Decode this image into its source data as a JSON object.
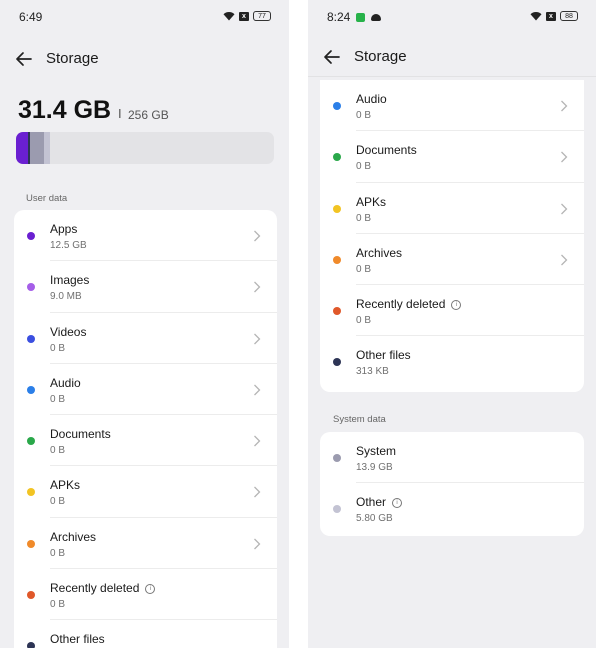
{
  "left": {
    "time": "6:49",
    "battery": "77",
    "title": "Storage",
    "used": "31.4 GB",
    "separator": "I",
    "capacity": "256 GB",
    "usage_fraction": 0.123,
    "section_user": "User data",
    "items": [
      {
        "label": "Apps",
        "value": "12.5 GB",
        "color": "#6a1fd1",
        "chevron": true,
        "info": false
      },
      {
        "label": "Images",
        "value": "9.0 MB",
        "color": "#a55ee8",
        "chevron": true,
        "info": false
      },
      {
        "label": "Videos",
        "value": "0 B",
        "color": "#3b4fe0",
        "chevron": true,
        "info": false
      },
      {
        "label": "Audio",
        "value": "0 B",
        "color": "#2b7fe8",
        "chevron": true,
        "info": false
      },
      {
        "label": "Documents",
        "value": "0 B",
        "color": "#2aa84a",
        "chevron": true,
        "info": false
      },
      {
        "label": "APKs",
        "value": "0 B",
        "color": "#f2c423",
        "chevron": true,
        "info": false
      },
      {
        "label": "Archives",
        "value": "0 B",
        "color": "#f08a2a",
        "chevron": true,
        "info": false
      },
      {
        "label": "Recently deleted",
        "value": "0 B",
        "color": "#e0582a",
        "chevron": false,
        "info": true
      },
      {
        "label": "Other files",
        "value": "",
        "color": "#2d3455",
        "chevron": false,
        "info": false
      }
    ]
  },
  "right": {
    "time": "8:24",
    "battery": "88",
    "title": "Storage",
    "items": [
      {
        "label": "Audio",
        "value": "0 B",
        "color": "#2b7fe8",
        "chevron": true,
        "info": false
      },
      {
        "label": "Documents",
        "value": "0 B",
        "color": "#2aa84a",
        "chevron": true,
        "info": false
      },
      {
        "label": "APKs",
        "value": "0 B",
        "color": "#f2c423",
        "chevron": true,
        "info": false
      },
      {
        "label": "Archives",
        "value": "0 B",
        "color": "#f08a2a",
        "chevron": true,
        "info": false
      },
      {
        "label": "Recently deleted",
        "value": "0 B",
        "color": "#e0582a",
        "chevron": false,
        "info": true
      },
      {
        "label": "Other files",
        "value": "313 KB",
        "color": "#2d3455",
        "chevron": false,
        "info": false
      }
    ],
    "section_system": "System data",
    "system_items": [
      {
        "label": "System",
        "value": "13.9 GB",
        "color": "#9b9baf",
        "chevron": false,
        "info": false
      },
      {
        "label": "Other",
        "value": "5.80 GB",
        "color": "#c3c3d3",
        "chevron": false,
        "info": true
      }
    ]
  },
  "icons": {
    "back": "arrow-left-icon",
    "chevron": "chevron-right-icon",
    "info": "info-icon",
    "wifi": "wifi-icon",
    "battery": "battery-icon"
  }
}
